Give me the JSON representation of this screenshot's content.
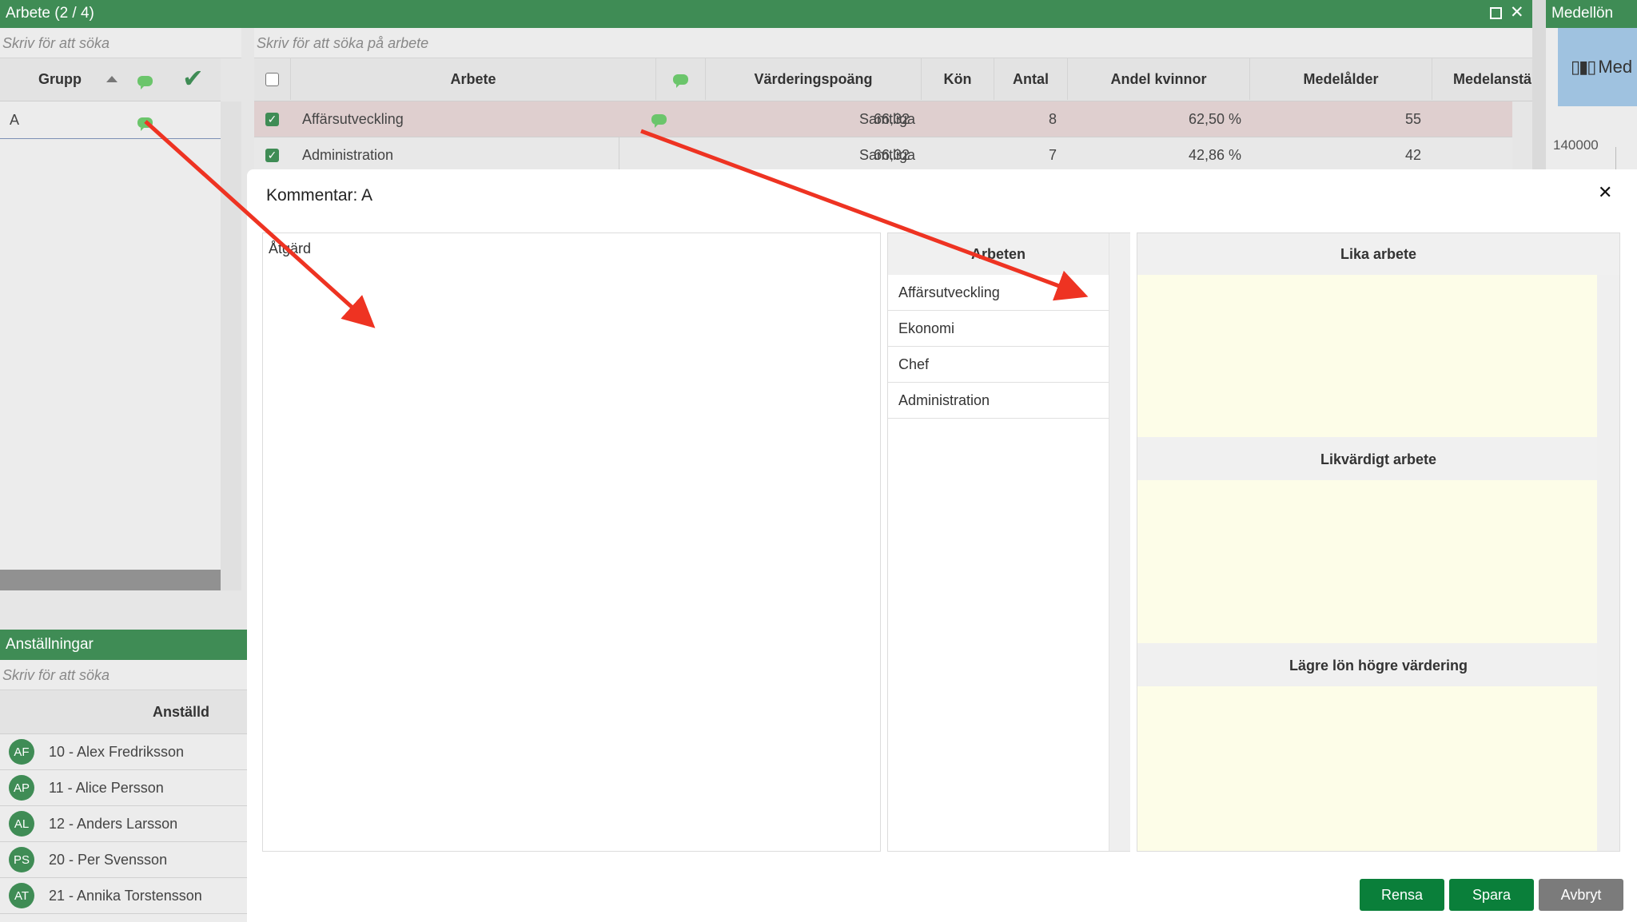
{
  "left_panel": {
    "title": "Arbete (2 / 4)",
    "search_placeholder": "Skriv för att söka",
    "header": {
      "group": "Grupp"
    },
    "rows": [
      {
        "name": "A"
      }
    ]
  },
  "main_table": {
    "search_placeholder": "Skriv för att söka på arbete",
    "headers": {
      "work": "Arbete",
      "score": "Värderingspoäng",
      "gender": "Kön",
      "count": "Antal",
      "women_share": "Andel kvinnor",
      "avg_age": "Medelålder",
      "avg_tenure": "Medelanställningsti"
    },
    "rows": [
      {
        "work": "Affärsutveckling",
        "score": "66,32",
        "gender": "Samtliga",
        "count": "8",
        "women_share": "62,50 %",
        "avg_age": "55"
      },
      {
        "work": "Administration",
        "score": "66,32",
        "gender": "Samtliga",
        "count": "7",
        "women_share": "42,86 %",
        "avg_age": "42"
      }
    ]
  },
  "right_panel": {
    "title": "Medellön",
    "tab_label": "Med",
    "axis_value": "140000"
  },
  "employees": {
    "title": "Anställningar",
    "search_placeholder": "Skriv för att söka",
    "header": "Anställd",
    "rows": [
      {
        "initials": "AF",
        "label": "10 - Alex Fredriksson"
      },
      {
        "initials": "AP",
        "label": "11 - Alice Persson"
      },
      {
        "initials": "AL",
        "label": "12 - Anders Larsson"
      },
      {
        "initials": "PS",
        "label": "20 - Per Svensson"
      },
      {
        "initials": "AT",
        "label": "21 - Annika Torstensson"
      }
    ]
  },
  "modal": {
    "title": "Kommentar: A",
    "close_glyph": "✕",
    "action_label": "Åtgärd",
    "works_header": "Arbeten",
    "works": [
      "Affärsutveckling",
      "Ekonomi",
      "Chef",
      "Administration"
    ],
    "sections": {
      "equal": "Lika arbete",
      "equivalent": "Likvärdigt arbete",
      "lower_pay": "Lägre lön högre värdering"
    },
    "buttons": {
      "clear": "Rensa",
      "save": "Spara",
      "cancel": "Avbryt"
    }
  },
  "colors": {
    "brand_green": "#3f8c55",
    "button_green": "#0a7f3a",
    "button_gray": "#7b7b7b",
    "highlight_row": "#dfcfcf",
    "comment_bubble": "#6bc56b",
    "annotation_arrow": "#ee3322"
  }
}
